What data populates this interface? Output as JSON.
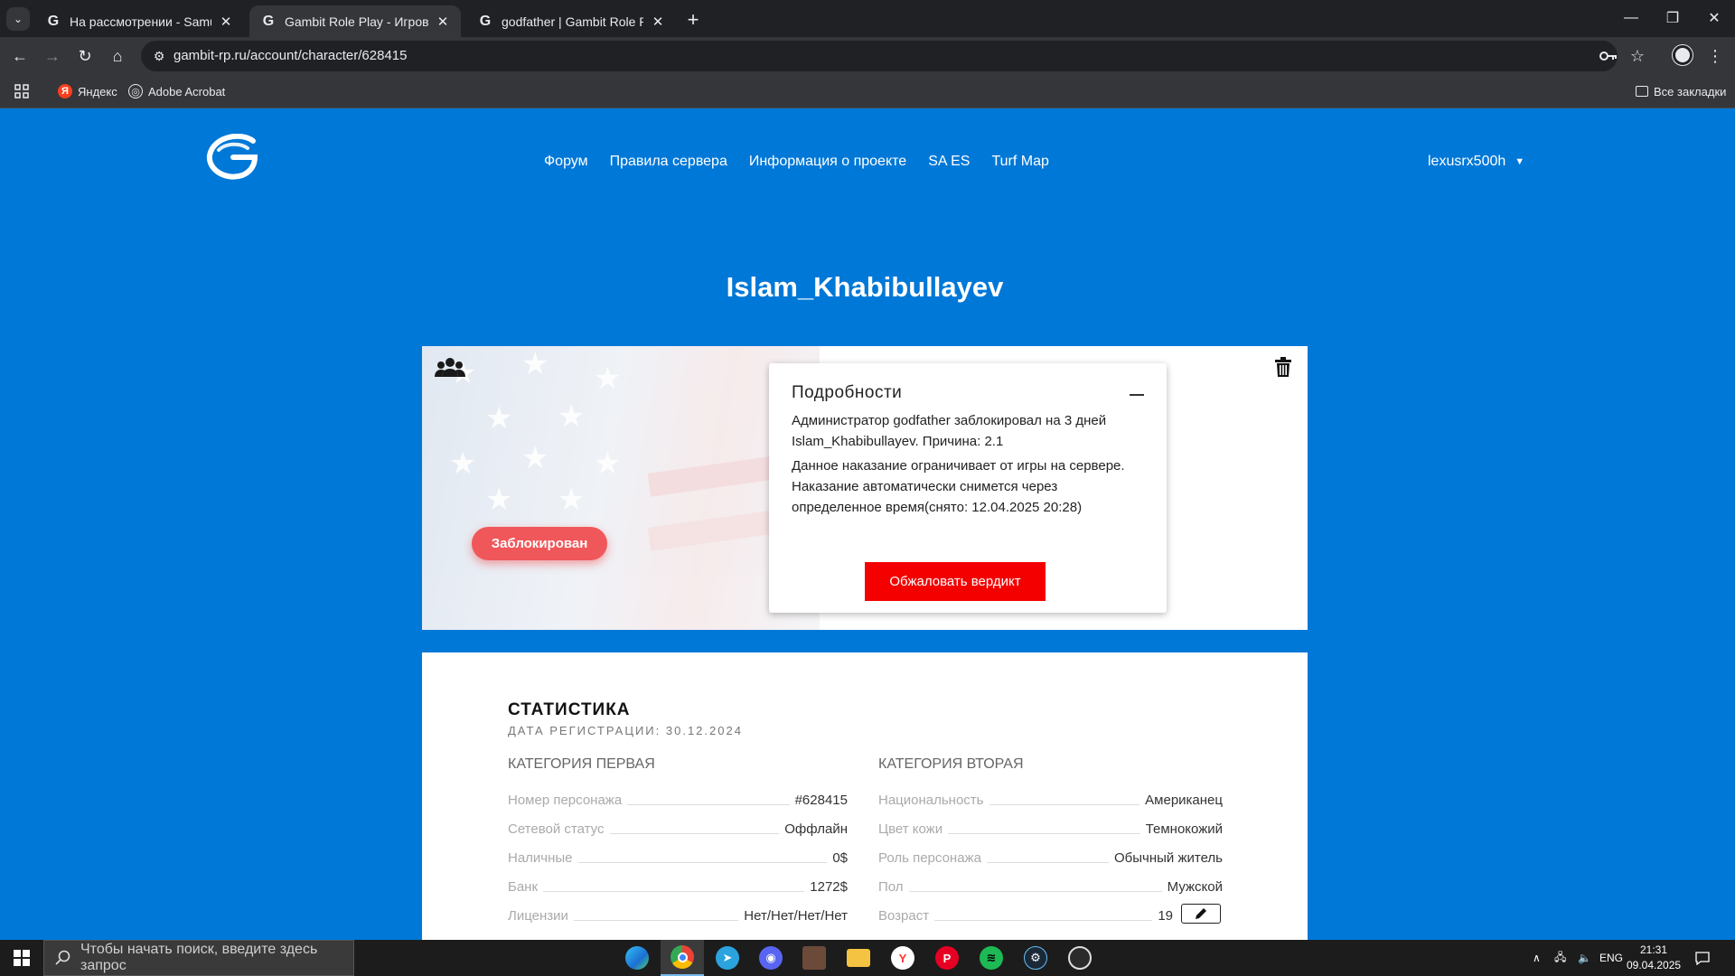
{
  "browser": {
    "tabs": [
      {
        "title": "На рассмотрении - Samuel Lic",
        "active": false
      },
      {
        "title": "Gambit Role Play - Игровой пр",
        "active": true
      },
      {
        "title": "godfather | Gambit Role Play - ",
        "active": false
      }
    ],
    "url": "gambit-rp.ru/account/character/628415",
    "bookmarks": [
      {
        "label": "Яндекс",
        "icon": "yandex-icon"
      },
      {
        "label": "Adobe Acrobat",
        "icon": "acrobat-icon"
      }
    ],
    "all_bookmarks": "Все закладки"
  },
  "site": {
    "nav": [
      "Форум",
      "Правила сервера",
      "Информация о проекте",
      "SA ES",
      "Turf Map"
    ],
    "username": "lexusrx500h"
  },
  "character": {
    "name": "Islam_Khabibullayev",
    "status_badge": "Заблокирован",
    "details": {
      "title": "Подробности",
      "text1": "Администратор godfather заблокировал на 3 дней Islam_Khabibullayev. Причина: 2.1",
      "text2": "Данное наказание ограничивает от игры на сервере. Наказание автоматически снимется через определенное время(снято: 12.04.2025 20:28)",
      "appeal_button": "Обжаловать вердикт"
    }
  },
  "stats": {
    "title": "СТАТИСТИКА",
    "registration": "ДАТА РЕГИСТРАЦИИ: 30.12.2024",
    "category1": {
      "title": "КАТЕГОРИЯ ПЕРВАЯ",
      "rows": [
        {
          "label": "Номер персонажа",
          "value": "#628415"
        },
        {
          "label": "Сетевой статус",
          "value": "Оффлайн"
        },
        {
          "label": "Наличные",
          "value": "0$"
        },
        {
          "label": "Банк",
          "value": "1272$"
        },
        {
          "label": "Лицензии",
          "value": "Нет/Нет/Нет/Нет"
        }
      ]
    },
    "category2": {
      "title": "КАТЕГОРИЯ ВТОРАЯ",
      "rows": [
        {
          "label": "Национальность",
          "value": "Американец"
        },
        {
          "label": "Цвет кожи",
          "value": "Темнокожий"
        },
        {
          "label": "Роль персонажа",
          "value": "Обычный житель"
        },
        {
          "label": "Пол",
          "value": "Мужской"
        },
        {
          "label": "Возраст",
          "value": "19"
        }
      ]
    }
  },
  "taskbar": {
    "search_placeholder": "Чтобы начать поиск, введите здесь запрос",
    "language": "ENG",
    "time": "21:31",
    "date": "09.04.2025"
  },
  "colors": {
    "page_bg": "#0078d7",
    "banned_badge": "#f0575a",
    "appeal_button": "#f40000"
  }
}
